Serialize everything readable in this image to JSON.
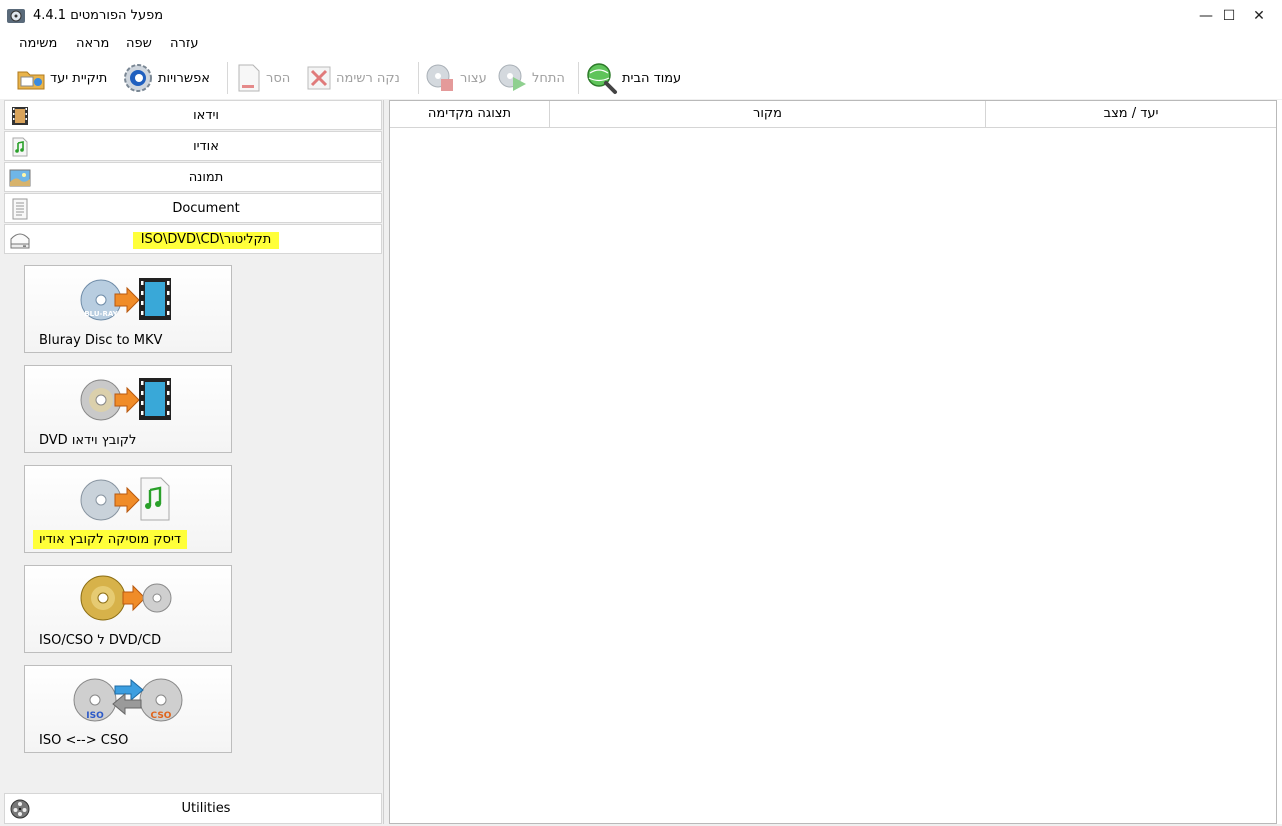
{
  "window": {
    "title": "מפעל הפורמטים 4.4.1",
    "minimize_glyph": "—",
    "maximize_glyph": "☐",
    "close_glyph": "✕"
  },
  "menu": {
    "items": [
      "משימה",
      "מראה",
      "שפה",
      "עזרה"
    ]
  },
  "toolbar": {
    "target_folder": "תיקיית יעד",
    "options": "אפשרויות",
    "remove": "הסר",
    "clear_list": "נקה רשימה",
    "stop": "עצור",
    "start": "התחל",
    "home_page": "עמוד הבית"
  },
  "categories": {
    "video": "וידאו",
    "audio": "אודיו",
    "picture": "תמונה",
    "document": "Document",
    "rom": "ISO\\DVD\\CD\\תקליטור",
    "utilities": "Utilities"
  },
  "tiles": {
    "bluray_to_mkv": "Bluray Disc to MKV",
    "dvd_to_video": "DVD לקובץ וידאו",
    "music_cd_to_audio": "דיסק מוסיקה לקובץ אודיו",
    "dvd_cd_to_iso": "ISO/CSO ל DVD/CD",
    "iso_cso": "ISO <--> CSO"
  },
  "file_list": {
    "col_preview": "תצוגה מקדימה",
    "col_source": "מקור",
    "col_output": "יעד / מצב"
  },
  "icon_text": {
    "bluray": "BLU-RAY",
    "iso": "ISO",
    "cso": "CSO"
  },
  "colors": {
    "highlight": "#ffff3a",
    "disabled_text": "#a0a0a0"
  }
}
